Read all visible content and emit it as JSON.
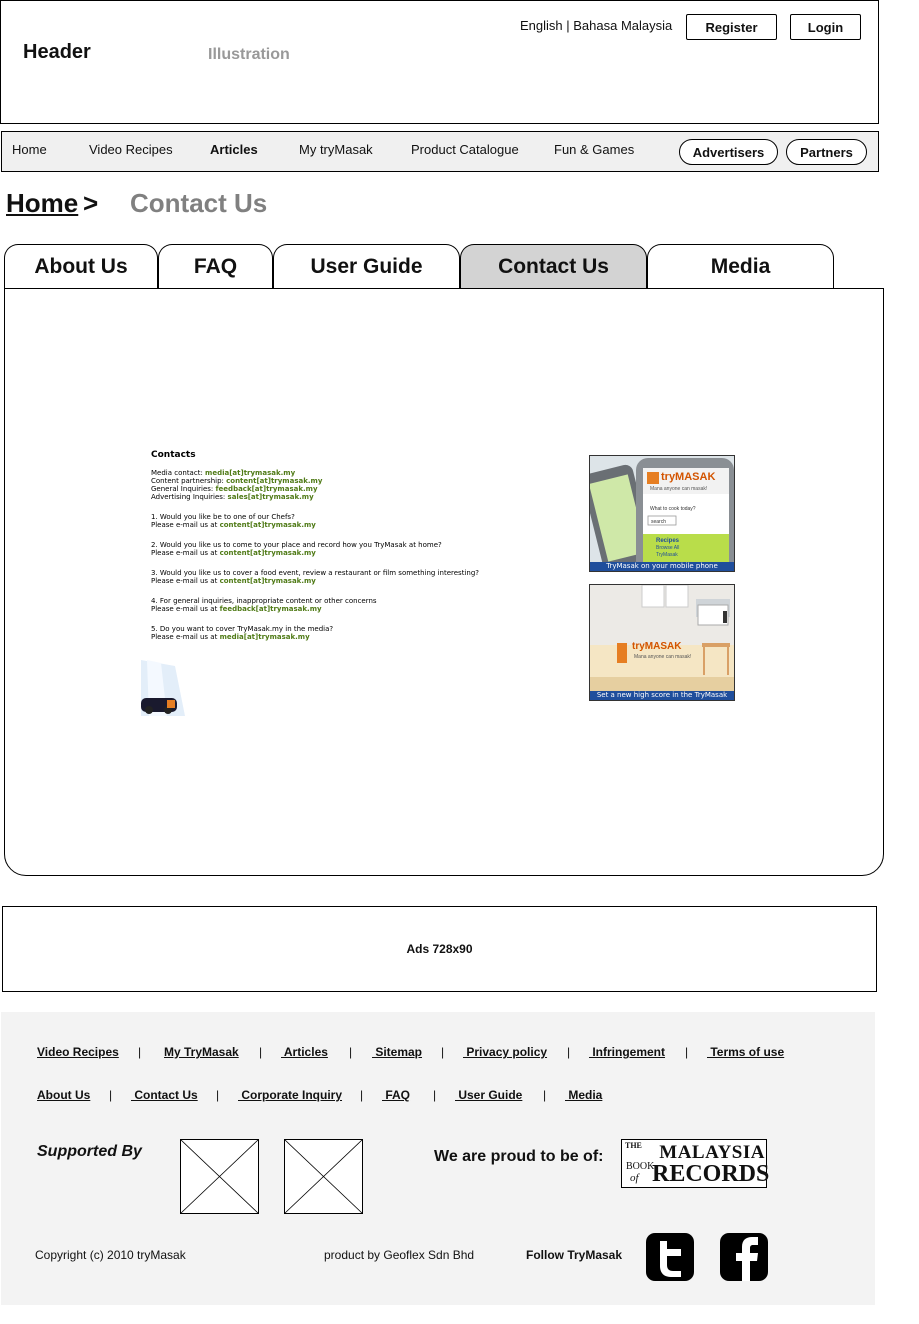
{
  "header": {
    "title": "Header",
    "illustration": "Illustration",
    "languages": "English | Bahasa Malaysia",
    "register_label": "Register",
    "login_label": "Login"
  },
  "nav": {
    "items": [
      {
        "label": "Home",
        "bold": false
      },
      {
        "label": "Video Recipes",
        "bold": false
      },
      {
        "label": "Articles",
        "bold": true
      },
      {
        "label": "My tryMasak",
        "bold": false
      },
      {
        "label": "Product Catalogue",
        "bold": false
      },
      {
        "label": "Fun & Games",
        "bold": false
      }
    ],
    "advertisers_label": "Advertisers",
    "partners_label": "Partners"
  },
  "breadcrumb": {
    "home": "Home",
    "separator": ">",
    "current": "Contact Us"
  },
  "tabs": [
    {
      "label": "About Us",
      "active": false
    },
    {
      "label": "FAQ",
      "active": false
    },
    {
      "label": "User Guide",
      "active": false
    },
    {
      "label": "Contact Us",
      "active": true
    },
    {
      "label": "Media",
      "active": false
    }
  ],
  "contacts": {
    "heading": "Contacts",
    "lines": [
      {
        "label": "Media contact:",
        "email": "media[at]trymasak.my"
      },
      {
        "label": "Content partnership:",
        "email": "content[at]trymasak.my"
      },
      {
        "label": "General Inquiries:",
        "email": "feedback[at]trymasak.my"
      },
      {
        "label": "Advertising Inquiries:",
        "email": "sales[at]trymasak.my"
      }
    ],
    "questions": [
      {
        "q": "1. Would you like be to one of our Chefs?",
        "prefix": "Please e-mail us at",
        "email": "content[at]trymasak.my"
      },
      {
        "q": "2. Would you like us to come to your place and record how you TryMasak at home?",
        "prefix": "Please e-mail us at",
        "email": "content[at]trymasak.my"
      },
      {
        "q": "3. Would you like us to cover a food event, review a restaurant or film something interesting?",
        "prefix": "Please e-mail us at",
        "email": "content[at]trymasak.my"
      },
      {
        "q": "4. For general inquiries, inappropriate content or other concerns",
        "prefix": "Please e-mail us at",
        "email": "feedback[at]trymasak.my"
      },
      {
        "q": "5. Do you want to cover TryMasak.my in the media?",
        "prefix": "Please e-mail us at",
        "email": "media[at]trymasak.my"
      }
    ]
  },
  "promos": {
    "mobile_caption": "TryMasak on your mobile phone",
    "mobile_brand": "tryMASAK",
    "mobile_tag": "Mana anyone can masak!",
    "mobile_field": "What to cook today?",
    "mobile_search": "search",
    "mobile_recipes": "Recipes",
    "mobile_browse": "Browse All",
    "mobile_trymasak": "TryMasak",
    "game_caption": "Set a new high score in the TryMasak game!",
    "game_brand": "tryMASAK",
    "game_tag": "Mana anyone can masak!"
  },
  "ads": {
    "label": "Ads 728x90"
  },
  "footer": {
    "row1": [
      "Video Recipes",
      "My TryMasak",
      " Articles",
      " Sitemap",
      " Privacy policy",
      " Infringement",
      " Terms of use"
    ],
    "row2": [
      "About Us",
      " Contact Us",
      " Corporate Inquiry",
      " FAQ",
      " User Guide",
      " Media"
    ],
    "separator": "|",
    "supported_by": "Supported By",
    "proud": "We are proud to be of:",
    "mbr_line1": "THE",
    "mbr_line2": "MALAYSIA",
    "mbr_line3": "BOOK",
    "mbr_line4": "of",
    "mbr_line5": "RECORDS",
    "copyright": "Copyright (c) 2010 tryMasak",
    "product_by": "product by Geoflex Sdn Bhd",
    "follow": "Follow TryMasak"
  }
}
